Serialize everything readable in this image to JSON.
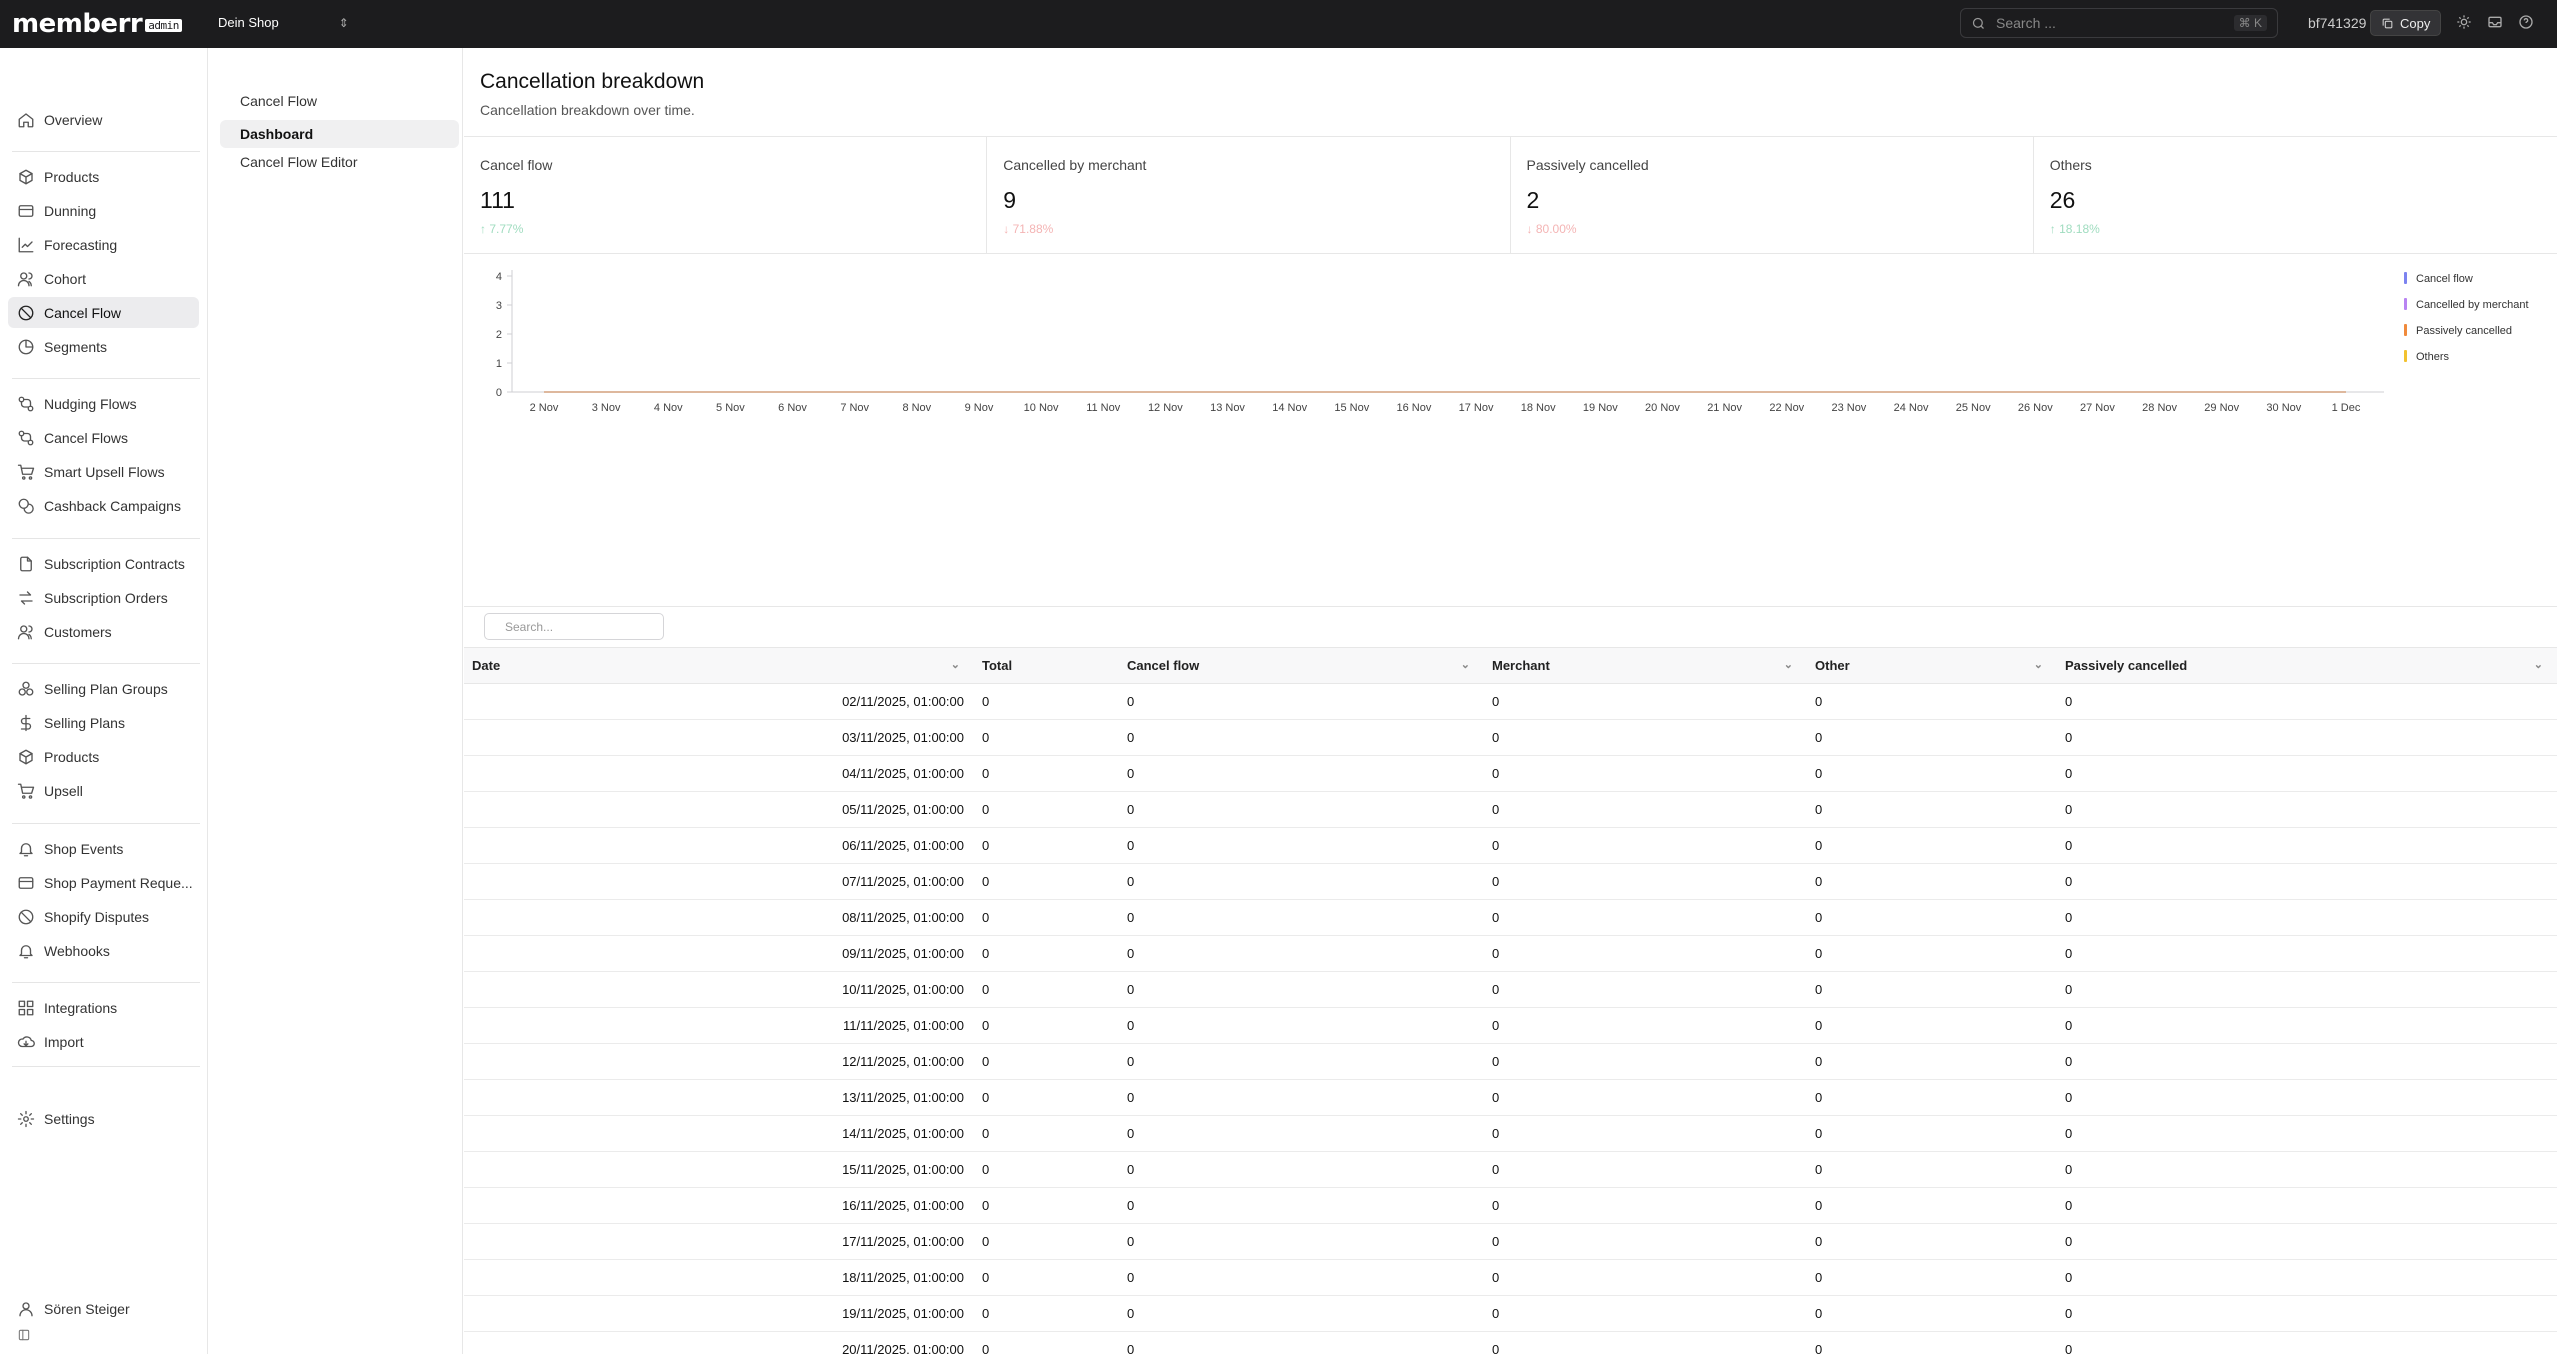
{
  "app": {
    "brand": "memberr",
    "badge": "admin"
  },
  "topbar": {
    "shop": "Dein Shop",
    "search_placeholder": "Search ...",
    "shortcut": "⌘ K",
    "store_id": "bf741329",
    "copy_label": "Copy"
  },
  "sidebar": {
    "items": [
      {
        "label": "Overview",
        "icon": "home-icon"
      },
      {
        "label": "Products",
        "icon": "package-icon"
      },
      {
        "label": "Dunning",
        "icon": "credit-card-icon"
      },
      {
        "label": "Forecasting",
        "icon": "trend-icon"
      },
      {
        "label": "Cohort",
        "icon": "users-icon"
      },
      {
        "label": "Cancel Flow",
        "icon": "ban-icon",
        "active": true
      },
      {
        "label": "Segments",
        "icon": "pie-icon"
      },
      {
        "label": "Nudging Flows",
        "icon": "flow-icon"
      },
      {
        "label": "Cancel Flows",
        "icon": "flow-icon"
      },
      {
        "label": "Smart Upsell Flows",
        "icon": "cart-icon"
      },
      {
        "label": "Cashback Campaigns",
        "icon": "coins-icon"
      },
      {
        "label": "Subscription Contracts",
        "icon": "files-icon"
      },
      {
        "label": "Subscription Orders",
        "icon": "arrows-icon"
      },
      {
        "label": "Customers",
        "icon": "users-icon"
      },
      {
        "label": "Selling Plan Groups",
        "icon": "group-icon"
      },
      {
        "label": "Selling Plans",
        "icon": "dollar-icon"
      },
      {
        "label": "Products",
        "icon": "package-icon"
      },
      {
        "label": "Upsell",
        "icon": "cart-icon"
      },
      {
        "label": "Shop Events",
        "icon": "bell-icon"
      },
      {
        "label": "Shop Payment Reque...",
        "icon": "credit-card-icon"
      },
      {
        "label": "Shopify Disputes",
        "icon": "ban-icon"
      },
      {
        "label": "Webhooks",
        "icon": "bell-icon"
      },
      {
        "label": "Integrations",
        "icon": "grid-icon"
      },
      {
        "label": "Import",
        "icon": "cloud-icon"
      },
      {
        "label": "Settings",
        "icon": "gear-icon"
      }
    ],
    "user": "Sören Steiger"
  },
  "subnav": {
    "items": [
      {
        "label": "Cancel Flow"
      },
      {
        "label": "Dashboard",
        "active": true
      },
      {
        "label": "Cancel Flow Editor"
      }
    ]
  },
  "main": {
    "title": "Cancellation breakdown",
    "subtitle": "Cancellation breakdown over time."
  },
  "stats": [
    {
      "label": "Cancel flow",
      "value": "111",
      "change": "7.77%",
      "direction": "up"
    },
    {
      "label": "Cancelled by merchant",
      "value": "9",
      "change": "71.88%",
      "direction": "down"
    },
    {
      "label": "Passively cancelled",
      "value": "2",
      "change": "80.00%",
      "direction": "down"
    },
    {
      "label": "Others",
      "value": "26",
      "change": "18.18%",
      "direction": "up"
    }
  ],
  "colors": {
    "cancel_flow": "#7c83f0",
    "merchant": "#b884f2",
    "passive": "#f08a3c",
    "others": "#f2c230",
    "up": "#9fdcbf",
    "down": "#f4b4b4"
  },
  "chart_data": {
    "type": "line",
    "x": [
      "2 Nov",
      "3 Nov",
      "4 Nov",
      "5 Nov",
      "6 Nov",
      "7 Nov",
      "8 Nov",
      "9 Nov",
      "10 Nov",
      "11 Nov",
      "12 Nov",
      "13 Nov",
      "14 Nov",
      "15 Nov",
      "16 Nov",
      "17 Nov",
      "18 Nov",
      "19 Nov",
      "20 Nov",
      "21 Nov",
      "22 Nov",
      "23 Nov",
      "24 Nov",
      "25 Nov",
      "26 Nov",
      "27 Nov",
      "28 Nov",
      "29 Nov",
      "30 Nov",
      "1 Dec"
    ],
    "y_ticks": [
      0,
      1,
      2,
      3,
      4
    ],
    "ylim": [
      0,
      4
    ],
    "series": [
      {
        "name": "Cancel flow",
        "values": [
          0,
          0,
          0,
          0,
          0,
          0,
          0,
          0,
          0,
          0,
          0,
          0,
          0,
          0,
          0,
          0,
          0,
          0,
          0,
          0,
          0,
          0,
          0,
          0,
          0,
          0,
          0,
          0,
          0,
          0
        ]
      },
      {
        "name": "Cancelled by merchant",
        "values": [
          0,
          0,
          0,
          0,
          0,
          0,
          0,
          0,
          0,
          0,
          0,
          0,
          0,
          0,
          0,
          0,
          0,
          0,
          0,
          0,
          0,
          0,
          0,
          0,
          0,
          0,
          0,
          0,
          0,
          0
        ]
      },
      {
        "name": "Passively cancelled",
        "values": [
          0,
          0,
          0,
          0,
          0,
          0,
          0,
          0,
          0,
          0,
          0,
          0,
          0,
          0,
          0,
          0,
          0,
          0,
          0,
          0,
          0,
          0,
          0,
          0,
          0,
          0,
          0,
          0,
          0,
          0
        ]
      },
      {
        "name": "Others",
        "values": [
          0,
          0,
          0,
          0,
          0,
          0,
          0,
          0,
          0,
          0,
          0,
          0,
          0,
          0,
          0,
          0,
          0,
          0,
          0,
          0,
          0,
          0,
          0,
          0,
          0,
          0,
          0,
          0,
          0,
          0
        ]
      }
    ],
    "legend": "top-right",
    "grid": false
  },
  "table": {
    "search_placeholder": "Search...",
    "columns": [
      "Date",
      "Total",
      "Cancel flow",
      "Merchant",
      "Other",
      "Passively cancelled"
    ],
    "rows": [
      [
        "02/11/2025, 01:00:00",
        "0",
        "0",
        "0",
        "0",
        "0"
      ],
      [
        "03/11/2025, 01:00:00",
        "0",
        "0",
        "0",
        "0",
        "0"
      ],
      [
        "04/11/2025, 01:00:00",
        "0",
        "0",
        "0",
        "0",
        "0"
      ],
      [
        "05/11/2025, 01:00:00",
        "0",
        "0",
        "0",
        "0",
        "0"
      ],
      [
        "06/11/2025, 01:00:00",
        "0",
        "0",
        "0",
        "0",
        "0"
      ],
      [
        "07/11/2025, 01:00:00",
        "0",
        "0",
        "0",
        "0",
        "0"
      ],
      [
        "08/11/2025, 01:00:00",
        "0",
        "0",
        "0",
        "0",
        "0"
      ],
      [
        "09/11/2025, 01:00:00",
        "0",
        "0",
        "0",
        "0",
        "0"
      ],
      [
        "10/11/2025, 01:00:00",
        "0",
        "0",
        "0",
        "0",
        "0"
      ],
      [
        "11/11/2025, 01:00:00",
        "0",
        "0",
        "0",
        "0",
        "0"
      ],
      [
        "12/11/2025, 01:00:00",
        "0",
        "0",
        "0",
        "0",
        "0"
      ],
      [
        "13/11/2025, 01:00:00",
        "0",
        "0",
        "0",
        "0",
        "0"
      ],
      [
        "14/11/2025, 01:00:00",
        "0",
        "0",
        "0",
        "0",
        "0"
      ],
      [
        "15/11/2025, 01:00:00",
        "0",
        "0",
        "0",
        "0",
        "0"
      ],
      [
        "16/11/2025, 01:00:00",
        "0",
        "0",
        "0",
        "0",
        "0"
      ],
      [
        "17/11/2025, 01:00:00",
        "0",
        "0",
        "0",
        "0",
        "0"
      ],
      [
        "18/11/2025, 01:00:00",
        "0",
        "0",
        "0",
        "0",
        "0"
      ],
      [
        "19/11/2025, 01:00:00",
        "0",
        "0",
        "0",
        "0",
        "0"
      ],
      [
        "20/11/2025, 01:00:00",
        "0",
        "0",
        "0",
        "0",
        "0"
      ]
    ]
  }
}
